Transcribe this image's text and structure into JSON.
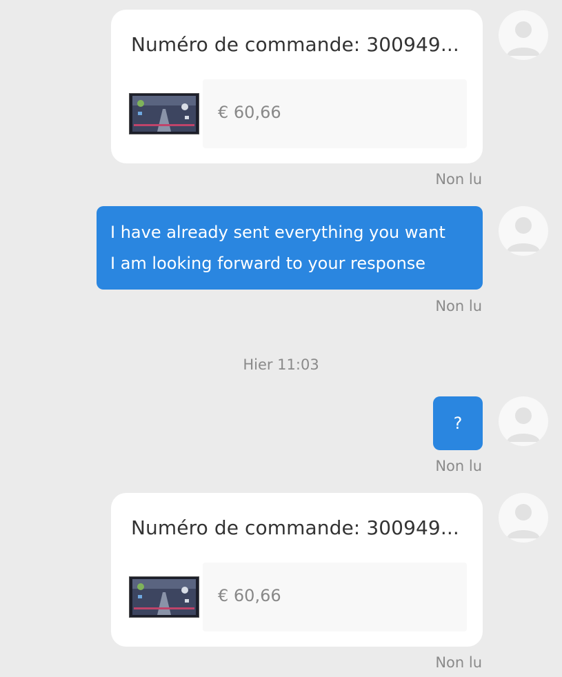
{
  "messages": {
    "order1": {
      "title": "Numéro de commande: 300949...",
      "price": "€ 60,66",
      "status": "Non lu"
    },
    "text1": {
      "lines": [
        "I have already sent everything you want",
        "I am looking forward to your response"
      ],
      "status": "Non lu"
    },
    "timestamp": "Hier 11:03",
    "question": {
      "text": "?",
      "status": "Non lu"
    },
    "order2": {
      "title": "Numéro de commande: 300949...",
      "price": "€ 60,66",
      "status": "Non lu"
    }
  },
  "colors": {
    "background": "#ebebeb",
    "bubble_blue": "#2a86e0",
    "card": "#ffffff",
    "muted_text": "#8a8a8a"
  },
  "icons": {
    "avatar": "default-user-avatar-icon",
    "product": "car-stereo-product-thumbnail"
  }
}
